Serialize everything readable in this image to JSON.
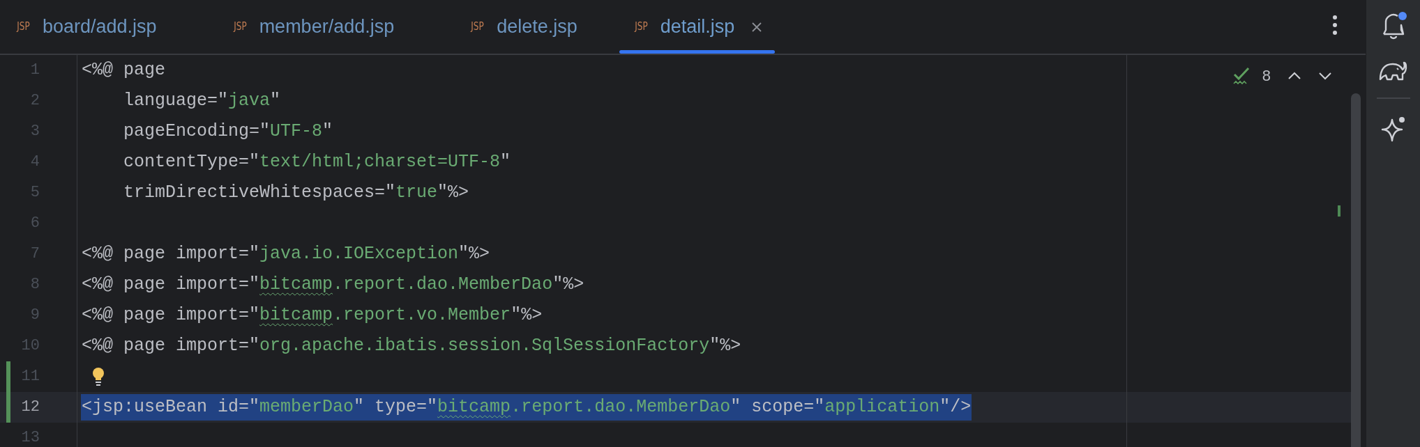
{
  "tabs": [
    {
      "file_type": "JSP",
      "label": "board/add.jsp",
      "selected": false
    },
    {
      "file_type": "JSP",
      "label": "member/add.jsp",
      "selected": false
    },
    {
      "file_type": "JSP",
      "label": "delete.jsp",
      "selected": false
    },
    {
      "file_type": "JSP",
      "label": "detail.jsp",
      "selected": true
    }
  ],
  "inspection": {
    "count": "8"
  },
  "notifications": {
    "unread": true
  },
  "lines": [
    {
      "number": "1",
      "changed": false,
      "current": false,
      "selected": false,
      "bulb": false,
      "tokens": [
        {
          "kind": "plain",
          "text": "<%@ page"
        }
      ]
    },
    {
      "number": "2",
      "changed": false,
      "current": false,
      "selected": false,
      "bulb": false,
      "tokens": [
        {
          "kind": "plain",
          "text": "    language=\""
        },
        {
          "kind": "string",
          "text": "java"
        },
        {
          "kind": "plain",
          "text": "\""
        }
      ]
    },
    {
      "number": "3",
      "changed": false,
      "current": false,
      "selected": false,
      "bulb": false,
      "tokens": [
        {
          "kind": "plain",
          "text": "    pageEncoding=\""
        },
        {
          "kind": "string",
          "text": "UTF-8"
        },
        {
          "kind": "plain",
          "text": "\""
        }
      ]
    },
    {
      "number": "4",
      "changed": false,
      "current": false,
      "selected": false,
      "bulb": false,
      "tokens": [
        {
          "kind": "plain",
          "text": "    contentType=\""
        },
        {
          "kind": "string",
          "text": "text/html;charset=UTF-8"
        },
        {
          "kind": "plain",
          "text": "\""
        }
      ]
    },
    {
      "number": "5",
      "changed": false,
      "current": false,
      "selected": false,
      "bulb": false,
      "tokens": [
        {
          "kind": "plain",
          "text": "    trimDirectiveWhitespaces=\""
        },
        {
          "kind": "string",
          "text": "true"
        },
        {
          "kind": "plain",
          "text": "\"%>"
        }
      ]
    },
    {
      "number": "6",
      "changed": false,
      "current": false,
      "selected": false,
      "bulb": false
    },
    {
      "number": "7",
      "changed": false,
      "current": false,
      "selected": false,
      "bulb": false,
      "tokens": [
        {
          "kind": "plain",
          "text": "<%@ page import=\""
        },
        {
          "kind": "string",
          "text": "java.io.IOException"
        },
        {
          "kind": "plain",
          "text": "\"%>"
        }
      ]
    },
    {
      "number": "8",
      "changed": false,
      "current": false,
      "selected": false,
      "bulb": false,
      "tokens": [
        {
          "kind": "plain",
          "text": "<%@ page import=\""
        },
        {
          "kind": "flagged",
          "text": "bitcamp"
        },
        {
          "kind": "string",
          "text": ".report.dao.MemberDao"
        },
        {
          "kind": "plain",
          "text": "\"%>"
        }
      ]
    },
    {
      "number": "9",
      "changed": false,
      "current": false,
      "selected": false,
      "bulb": false,
      "tokens": [
        {
          "kind": "plain",
          "text": "<%@ page import=\""
        },
        {
          "kind": "flagged",
          "text": "bitcamp"
        },
        {
          "kind": "string",
          "text": ".report.vo.Member"
        },
        {
          "kind": "plain",
          "text": "\"%>"
        }
      ]
    },
    {
      "number": "10",
      "changed": false,
      "current": false,
      "selected": false,
      "bulb": false,
      "tokens": [
        {
          "kind": "plain",
          "text": "<%@ page import=\""
        },
        {
          "kind": "string",
          "text": "org.apache.ibatis.session.SqlSessionFactory"
        },
        {
          "kind": "plain",
          "text": "\"%>"
        }
      ]
    },
    {
      "number": "11",
      "changed": true,
      "current": false,
      "selected": false,
      "bulb": true
    },
    {
      "number": "12",
      "changed": true,
      "current": true,
      "selected": true,
      "bulb": false,
      "tokens": [
        {
          "kind": "plain",
          "text": "<jsp:useBean id=\""
        },
        {
          "kind": "string",
          "text": "memberDao"
        },
        {
          "kind": "plain",
          "text": "\" type=\""
        },
        {
          "kind": "flagged",
          "text": "bitcamp"
        },
        {
          "kind": "string",
          "text": ".report.dao.MemberDao"
        },
        {
          "kind": "plain",
          "text": "\" scope=\""
        },
        {
          "kind": "string",
          "text": "application"
        },
        {
          "kind": "plain",
          "text": "\"/>"
        }
      ]
    },
    {
      "number": "13",
      "changed": false,
      "current": false,
      "selected": false,
      "bulb": false
    }
  ]
}
